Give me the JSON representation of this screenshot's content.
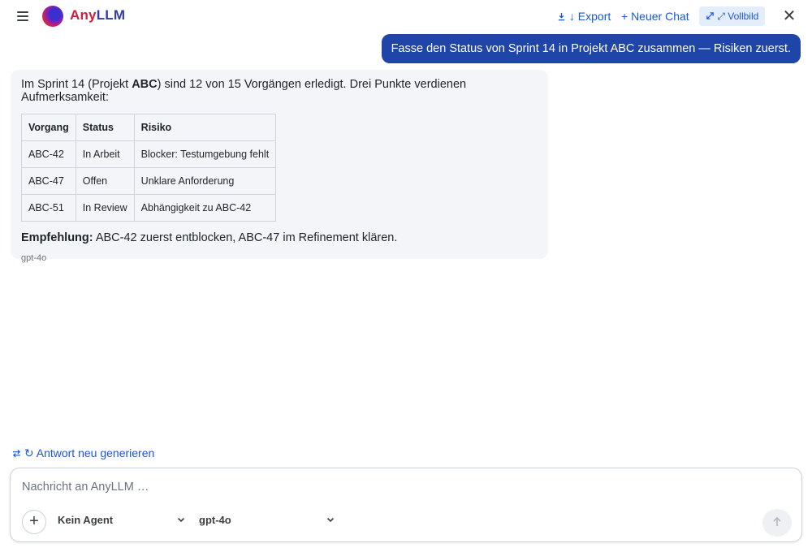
{
  "header": {
    "brand_part1": "Any",
    "brand_part2": "LLM",
    "export_label": "↓ Export",
    "new_chat_label": "+ Neuer Chat",
    "fullscreen_label": "⤢ Vollbild"
  },
  "chat": {
    "user_message": "Fasse den Status von Sprint 14 in Projekt ABC zusammen — Risiken zuerst.",
    "assistant": {
      "intro_before": "Im Sprint 14 (Projekt ",
      "intro_bold": "ABC",
      "intro_after": ") sind 12 von 15 Vorgängen erledigt. Drei Punkte verdienen Aufmerksamkeit:",
      "table": {
        "headers": [
          "Vorgang",
          "Status",
          "Risiko"
        ],
        "rows": [
          [
            "ABC-42",
            "In Arbeit",
            "Blocker: Testumgebung fehlt"
          ],
          [
            "ABC-47",
            "Offen",
            "Unklare Anforderung"
          ],
          [
            "ABC-51",
            "In Review",
            "Abhängigkeit zu ABC-42"
          ]
        ]
      },
      "recommendation_label": "Empfehlung:",
      "recommendation_text": " ABC-42 zuerst entblocken, ABC-47 im Refinement klären.",
      "model": "gpt-4o"
    },
    "regenerate_label": "↻ Antwort neu generieren"
  },
  "composer": {
    "placeholder": "Nachricht an AnyLLM …",
    "agent_value": "Kein Agent",
    "model_value": "gpt-4o"
  },
  "icons": {
    "menu": "hamburger-menu-icon",
    "export": "download-icon",
    "fullscreen": "expand-icon",
    "close": "close-icon",
    "regenerate": "swap-arrows-icon",
    "attach": "plus-icon",
    "send": "arrow-up-icon"
  },
  "colors": {
    "accent": "#1a56db",
    "user_bubble": "#1f45a8",
    "brand_red": "#d11d3b",
    "brand_blue": "#2f3ba8"
  }
}
